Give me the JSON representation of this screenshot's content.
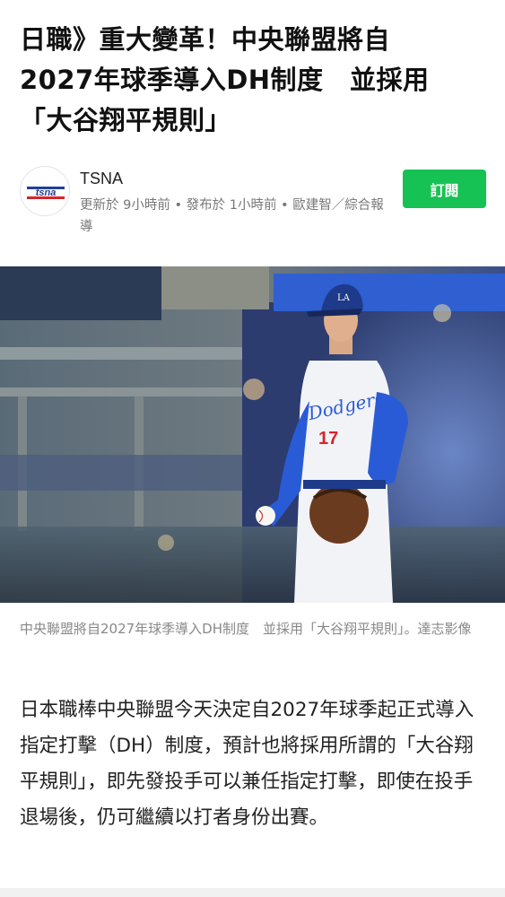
{
  "article": {
    "title_line1": "日職》重大變革！中央聯盟將自",
    "title_line2": "2027年球季導入DH制度　並採用",
    "title_line3": "「大谷翔平規則」"
  },
  "source": {
    "name": "TSNA",
    "logo_text": "tsna",
    "meta": "更新於 9小時前 • 發布於 1小時前 • 歐建智／綜合報導",
    "subscribe_label": "訂閱"
  },
  "photo": {
    "caption": "中央聯盟將自2027年球季導入DH制度　並採用「大谷翔平規則」。達志影像",
    "expand_icon": "expand-arrows-icon"
  },
  "body": {
    "paragraph": "日本職棒中央聯盟今天決定自2027年球季起正式導入指定打擊（DH）制度，預計也將採用所謂的「大谷翔平規則」，即先發投手可以兼任指定打擊，即使在投手退場後，仍可繼續以打者身份出賽。"
  },
  "colors": {
    "subscribe_bg": "#16c253",
    "jersey_blue": "#2a5bd7"
  }
}
